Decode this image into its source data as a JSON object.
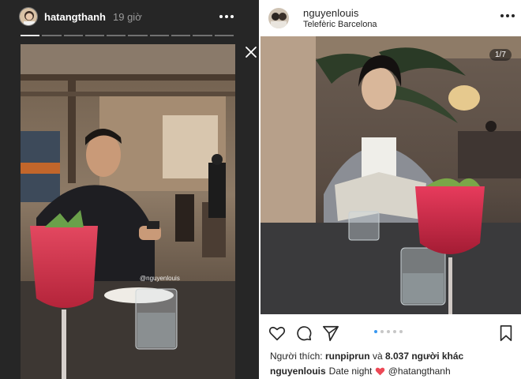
{
  "story": {
    "username": "hatangthanh",
    "time": "19 giờ",
    "progress_segments": 10,
    "progress_active": 1,
    "photo_tag": "@nguyenlouis"
  },
  "post": {
    "username": "nguyenlouis",
    "location": "Telefèric Barcelona",
    "image_counter": "1/7",
    "carousel_dots": 5,
    "carousel_active": 1,
    "likes_label": "Người thích:",
    "likes_user": "runpiprun",
    "likes_and": "và",
    "likes_others": "8.037 người khác",
    "caption_user": "nguyenlouis",
    "caption_text": "Date night",
    "caption_mention": "@hatangthanh"
  },
  "colors": {
    "story_bg": "#262626",
    "pager_active": "#3897f0",
    "heart": "#ed4956"
  },
  "icons": [
    "more-icon",
    "close-icon",
    "heart-icon",
    "comment-icon",
    "share-icon",
    "bookmark-icon"
  ]
}
